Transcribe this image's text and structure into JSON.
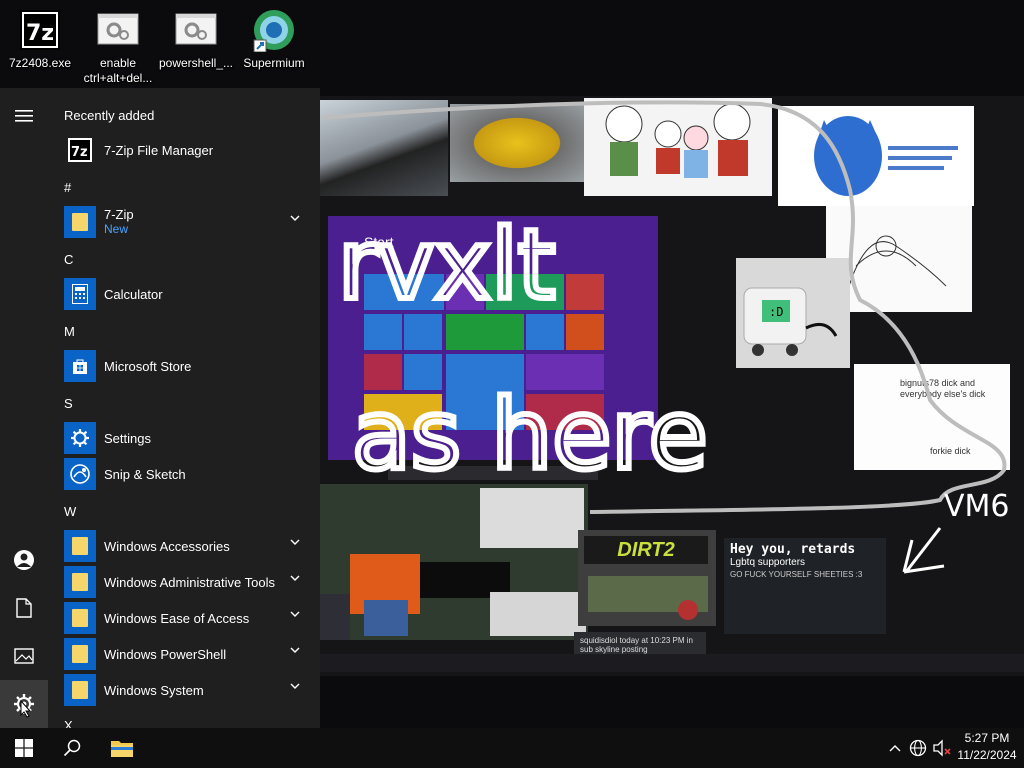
{
  "desktop": {
    "icons": [
      {
        "label": "7z2408.exe",
        "icon": "7zip-installer-icon"
      },
      {
        "label": "enable ctrl+alt+del...",
        "icon": "settings-file-icon"
      },
      {
        "label": "powershell_...",
        "icon": "settings-file-icon"
      },
      {
        "label": "Supermium",
        "icon": "supermium-browser-icon"
      }
    ]
  },
  "wallpaper": {
    "scribble_text": [
      "rvxlt",
      "as here",
      "VM6"
    ],
    "note_text": [
      "bignuts78 dick and everybody else's dick",
      "forkie dick"
    ],
    "chat_title": "Hey you, retards",
    "chat_subtitle": "Lgbtq supporters",
    "chat_line": "GO FUCK YOURSELF SHEETIES :3",
    "game_logo": "DIRT2",
    "win8_start": "Start",
    "snippet": "squidisdiol  today at 10:23 PM in sub skyline posting"
  },
  "start_menu": {
    "recently_added_header": "Recently added",
    "recent": [
      {
        "label": "7-Zip File Manager",
        "icon": "7zip-icon"
      }
    ],
    "sections": [
      {
        "letter": "#",
        "items": [
          {
            "label": "7-Zip",
            "sub": "New",
            "icon": "folder-icon",
            "expandable": true
          }
        ]
      },
      {
        "letter": "C",
        "items": [
          {
            "label": "Calculator",
            "icon": "calculator-icon"
          }
        ]
      },
      {
        "letter": "M",
        "items": [
          {
            "label": "Microsoft Store",
            "icon": "store-icon"
          }
        ]
      },
      {
        "letter": "S",
        "items": [
          {
            "label": "Settings",
            "icon": "gear-icon"
          },
          {
            "label": "Snip & Sketch",
            "icon": "snip-sketch-icon"
          }
        ]
      },
      {
        "letter": "W",
        "items": [
          {
            "label": "Windows Accessories",
            "icon": "folder-icon",
            "expandable": true
          },
          {
            "label": "Windows Administrative Tools",
            "icon": "folder-icon",
            "expandable": true
          },
          {
            "label": "Windows Ease of Access",
            "icon": "folder-icon",
            "expandable": true
          },
          {
            "label": "Windows PowerShell",
            "icon": "folder-icon",
            "expandable": true
          },
          {
            "label": "Windows System",
            "icon": "folder-icon",
            "expandable": true
          }
        ]
      },
      {
        "letter": "X",
        "items": []
      }
    ],
    "rail": [
      "hamburger-menu-icon",
      "user-icon",
      "documents-icon",
      "pictures-icon",
      "settings-gear-icon"
    ]
  },
  "taskbar": {
    "pinned": [
      "windows-start-icon",
      "search-icon",
      "file-explorer-icon"
    ],
    "tray": [
      "show-hidden-icons-chevron",
      "network-globe-icon",
      "volume-muted-icon"
    ],
    "time": "5:27 PM",
    "date": "11/22/2024"
  },
  "colors": {
    "start_bg": "#1f1f1f",
    "tile_blue": "#0a64c8",
    "accent_link": "#4aa3ff",
    "taskbar_bg": "#0f0f10",
    "folder_yellow": "#f6d66a"
  }
}
